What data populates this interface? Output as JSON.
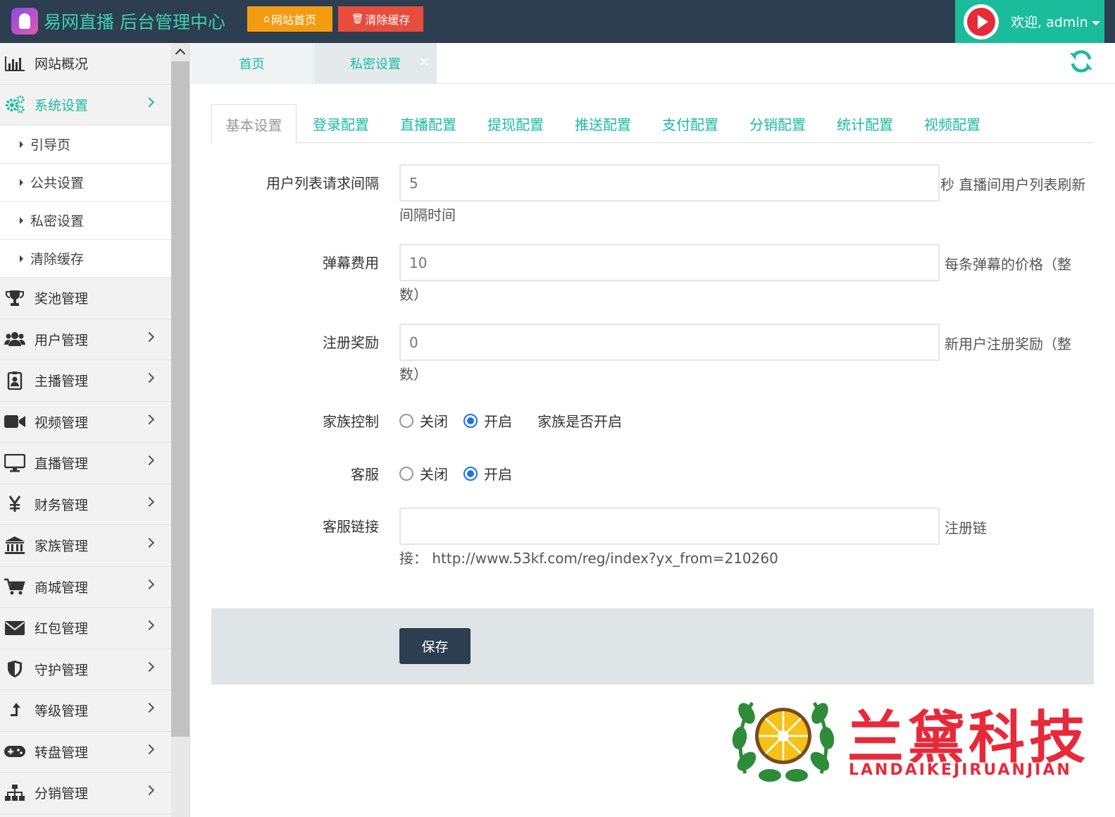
{
  "header": {
    "title": "易网直播 后台管理中心",
    "home_button": "网站首页",
    "clear_cache_button": "清除缓存",
    "welcome": "欢迎, admin"
  },
  "sidebar": {
    "items": [
      {
        "label": "网站概况",
        "icon": "bar-chart-icon"
      },
      {
        "label": "系统设置",
        "icon": "gears-icon",
        "active": true
      },
      {
        "label": "奖池管理",
        "icon": "trophy-icon"
      },
      {
        "label": "用户管理",
        "icon": "users-icon"
      },
      {
        "label": "主播管理",
        "icon": "id-badge-icon"
      },
      {
        "label": "视频管理",
        "icon": "video-camera-icon"
      },
      {
        "label": "直播管理",
        "icon": "monitor-icon"
      },
      {
        "label": "财务管理",
        "icon": "yen-icon"
      },
      {
        "label": "家族管理",
        "icon": "bank-icon"
      },
      {
        "label": "商城管理",
        "icon": "cart-icon"
      },
      {
        "label": "红包管理",
        "icon": "envelope-icon"
      },
      {
        "label": "守护管理",
        "icon": "shield-icon"
      },
      {
        "label": "等级管理",
        "icon": "level-up-icon"
      },
      {
        "label": "转盘管理",
        "icon": "gamepad-icon"
      },
      {
        "label": "分销管理",
        "icon": "sitemap-icon"
      }
    ],
    "sub_items": [
      "引导页",
      "公共设置",
      "私密设置",
      "清除缓存"
    ]
  },
  "page_tabs": [
    {
      "label": "首页"
    },
    {
      "label": "私密设置",
      "close": "×"
    }
  ],
  "settings_tabs": [
    "基本设置",
    "登录配置",
    "直播配置",
    "提现配置",
    "推送配置",
    "支付配置",
    "分销配置",
    "统计配置",
    "视频配置"
  ],
  "form": {
    "user_list_interval": {
      "label": "用户列表请求间隔",
      "value": "5",
      "help_right": "秒 直播间用户列表刷新",
      "help_below": "间隔时间"
    },
    "barrage_fee": {
      "label": "弹幕费用",
      "value": "10",
      "help_right": "每条弹幕的价格（整",
      "help_below": "数）"
    },
    "register_reward": {
      "label": "注册奖励",
      "value": "0",
      "help_right": "新用户注册奖励（整",
      "help_below": "数）"
    },
    "family_control": {
      "label": "家族控制",
      "off": "关闭",
      "on": "开启",
      "selected": "on",
      "help": "家族是否开启"
    },
    "customer_service": {
      "label": "客服",
      "off": "关闭",
      "on": "开启",
      "selected": "on"
    },
    "service_link": {
      "label": "客服链接",
      "value": "",
      "help_right": "注册链",
      "help_below": "接：  http://www.53kf.com/reg/index?yx_from=210260"
    }
  },
  "save_button": "保存",
  "watermark": {
    "name": "兰黛科技",
    "sub": "LANDAIKEJIRUANJIAN"
  },
  "colors": {
    "header_bg": "#2c3e50",
    "accent": "#1abc9c",
    "orange": "#f39c12",
    "red": "#e74c3c",
    "watermark": "#e8293a"
  }
}
